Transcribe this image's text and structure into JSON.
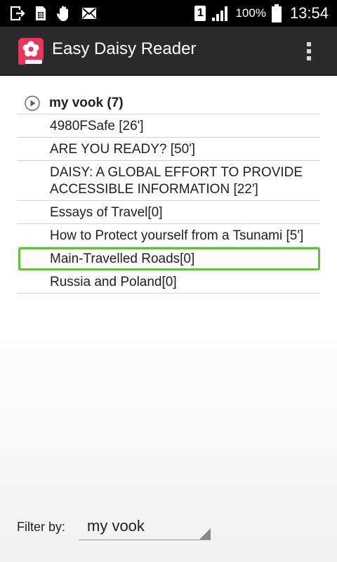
{
  "status_bar": {
    "icons": [
      "exit-app-icon",
      "sim-card-icon",
      "hand-icon",
      "mail-icon"
    ],
    "sim_slot": "1",
    "battery_percent": "100%",
    "time": "13:54",
    "colors": {
      "background": "#000000",
      "foreground": "#ffffff"
    }
  },
  "app_bar": {
    "title": "Easy Daisy Reader",
    "icon": "daisy-book-icon",
    "menu_icon": "overflow-menu-icon",
    "colors": {
      "background": "#2b2b2b",
      "accent": "#e8355c"
    }
  },
  "book_list": {
    "group": {
      "label": "my vook (7)",
      "icon": "play-circle-icon"
    },
    "items": [
      {
        "title": "4980FSafe [26']"
      },
      {
        "title": "ARE YOU READY? [50']"
      },
      {
        "title": "DAISY: A GLOBAL EFFORT TO PROVIDE ACCESSIBLE INFORMATION [22']"
      },
      {
        "title": "Essays of Travel[0]"
      },
      {
        "title": "How to Protect yourself from a Tsunami [5']"
      },
      {
        "title": "Main-Travelled Roads[0]"
      },
      {
        "title": "Russia and Poland[0]"
      }
    ],
    "focused_index": 5,
    "focus_color": "#66c03c"
  },
  "filter": {
    "label": "Filter by:",
    "selected": "my vook"
  }
}
